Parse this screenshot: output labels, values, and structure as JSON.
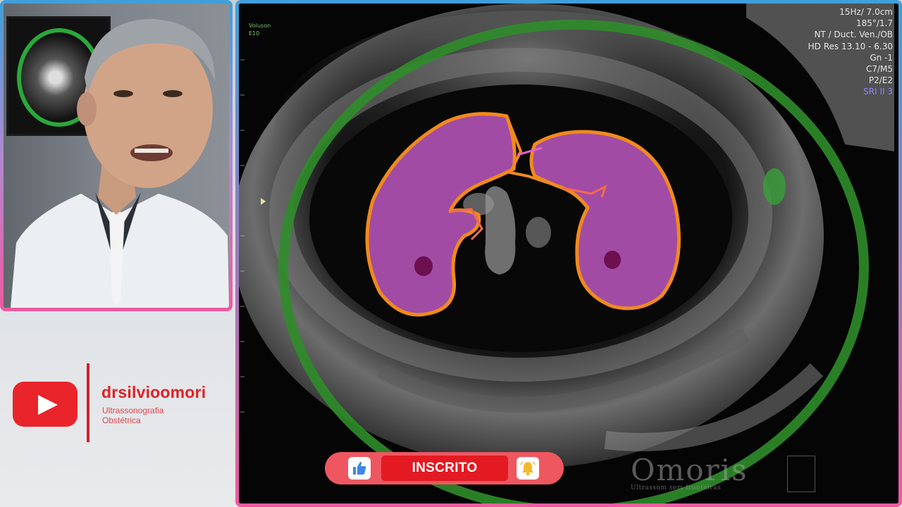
{
  "channel": {
    "name": "drsilvioomori",
    "subtitle_line1": "Ultrassonografia",
    "subtitle_line2": "Obstétrica"
  },
  "ultrasound": {
    "probe_label_line1": "Voluson",
    "probe_label_line2": "E10",
    "parameters": [
      "15Hz/ 7.0cm",
      "185°/1.7",
      "NT / Duct. Ven./OB",
      "HD Res 13.10 - 6.30",
      "Gn -1",
      "C7/M5",
      "P2/E2"
    ],
    "sri_label": "SRI II 3",
    "watermark_text": "Omoris",
    "watermark_subtext": "Ultrassom sem fronteiras"
  },
  "subscribe_bar": {
    "button_label": "INSCRITO"
  },
  "colors": {
    "brand_red": "#e31a22",
    "border_blue": "#3f9fd9",
    "border_pink": "#ef5aa0",
    "annotation_green": "#2f8d2a",
    "annotation_orange": "#f08a1c",
    "annotation_magenta": "#c45ac8"
  }
}
